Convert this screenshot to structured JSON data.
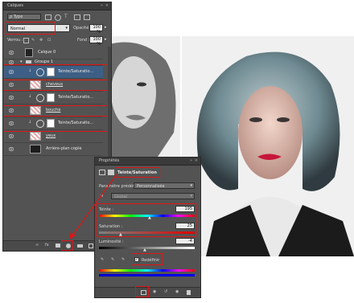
{
  "colors": {
    "panel_bg": "#535353",
    "titlebar_bg": "#3a3a3a",
    "annotation_red": "#e01515",
    "selected_row": "#3d5f86"
  },
  "layers_panel": {
    "tab_title": "Calques",
    "filter_label": "Type",
    "blend_mode": "Normal",
    "opacity_label": "Opacité :",
    "opacity_value": "100 %",
    "lock_label": "Verrou :",
    "fill_label": "Fond :",
    "fill_value": "100 %",
    "layers": [
      {
        "name": "Calque 0"
      },
      {
        "name": "Groupe 1"
      },
      {
        "name": "Teinte/Saturatio..."
      },
      {
        "name": "cheveux"
      },
      {
        "name": "Teinte/Saturatio..."
      },
      {
        "name": "bouche"
      },
      {
        "name": "Teinte/Saturatio..."
      },
      {
        "name": "yeux"
      },
      {
        "name": "Arrière-plan copie"
      }
    ]
  },
  "properties_panel": {
    "tab_title": "Propriétés",
    "adjustment_title": "Teinte/Saturation",
    "preset_label": "Paramètre prédéfini :",
    "preset_value": "Personnalisée",
    "channel_value": "Global",
    "hue_label": "Teinte :",
    "hue_value": "195",
    "saturation_label": "Saturation :",
    "saturation_value": "25",
    "lightness_label": "Luminosité :",
    "lightness_value": "-4",
    "colorize_label": "Redéfinir",
    "colorize_checked": true
  }
}
